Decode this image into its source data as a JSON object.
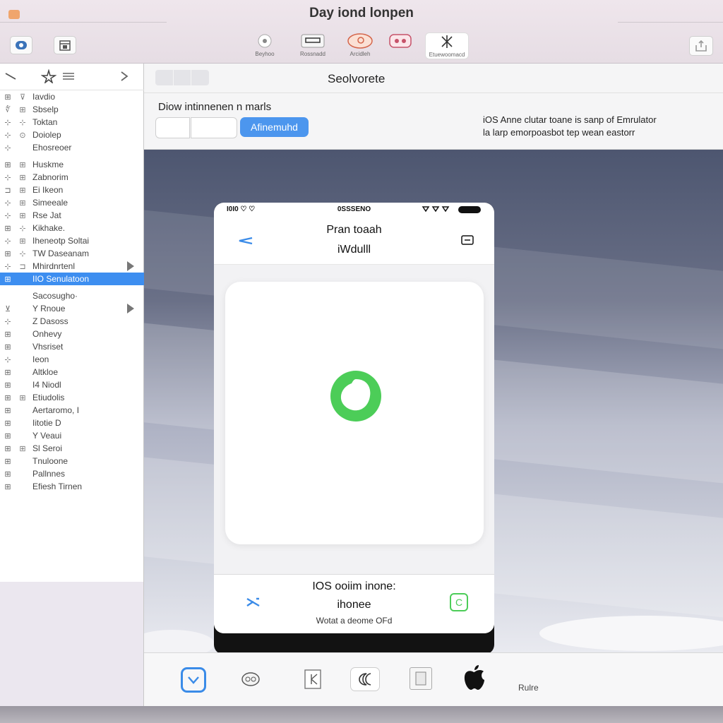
{
  "window": {
    "title": "Day iond lonpen"
  },
  "toolbar": {
    "tools": [
      {
        "label": "Beyhoo",
        "icon": "disc-icon"
      },
      {
        "label": "Rossnadd",
        "icon": "device-icon"
      },
      {
        "label": "Arcidleh",
        "icon": "cloud-icon"
      },
      {
        "label": "",
        "icon": "tag-icon"
      },
      {
        "label": "Etuewoomacd",
        "icon": "grid-icon"
      }
    ]
  },
  "sidebar": {
    "items": [
      {
        "label": "Iavdio",
        "icon1": "⊞",
        "icon2": "⊽"
      },
      {
        "label": "Sbselp",
        "icon1": "∜",
        "icon2": "⊞"
      },
      {
        "label": "Toktan",
        "icon1": "⊹",
        "icon2": "⊹"
      },
      {
        "label": "Doiolep",
        "icon1": "⊹",
        "icon2": "⊙"
      },
      {
        "label": "Ehosreoer",
        "icon1": "⊹",
        "icon2": ""
      },
      {
        "label": "Huskme",
        "icon1": "⊞",
        "icon2": "⊞"
      },
      {
        "label": "Zabnorim",
        "icon1": "⊹",
        "icon2": "⊞"
      },
      {
        "label": "Ei Ikeon",
        "icon1": "⊐",
        "icon2": "⊞"
      },
      {
        "label": "Simeeale",
        "icon1": "⊹",
        "icon2": "⊞"
      },
      {
        "label": "Rse Jat",
        "icon1": "⊹",
        "icon2": "⊞"
      },
      {
        "label": "Kikhake.",
        "icon1": "⊞",
        "icon2": "⊹"
      },
      {
        "label": "Iheneotp Soltai",
        "icon1": "⊹",
        "icon2": "⊞"
      },
      {
        "label": "TW Daseanam",
        "icon1": "⊞",
        "icon2": "⊹"
      },
      {
        "label": "Mhirdnrtenl",
        "icon1": "⊹",
        "icon2": "⊐",
        "arrow": true
      },
      {
        "label": "IIO Senulatoon",
        "icon1": "⊞",
        "icon2": "",
        "selected": true
      },
      {
        "label": "Sacosugho·",
        "icon1": "",
        "icon2": ""
      },
      {
        "label": "Y Rnoue",
        "icon1": "⊻",
        "icon2": "",
        "arrow": true
      },
      {
        "label": "Z Dasoss",
        "icon1": "⊹",
        "icon2": ""
      },
      {
        "label": "Onhevy",
        "icon1": "⊞",
        "icon2": ""
      },
      {
        "label": "Vhsriset",
        "icon1": "⊞",
        "icon2": ""
      },
      {
        "label": "Ieon",
        "icon1": "⊹",
        "icon2": ""
      },
      {
        "label": "Altkloe",
        "icon1": "⊞",
        "icon2": ""
      },
      {
        "label": "I4 Niodl",
        "icon1": "⊞",
        "icon2": ""
      },
      {
        "label": "Etiudolis",
        "icon1": "⊞",
        "icon2": "⊞"
      },
      {
        "label": "Aertaromo, I",
        "icon1": "⊞",
        "icon2": ""
      },
      {
        "label": "Iitotie D",
        "icon1": "⊞",
        "icon2": ""
      },
      {
        "label": "Y Veaui",
        "icon1": "⊞",
        "icon2": ""
      },
      {
        "label": "Sl Seroi",
        "icon1": "⊞",
        "icon2": "⊞"
      },
      {
        "label": "Tnuloone",
        "icon1": "⊞",
        "icon2": ""
      },
      {
        "label": "Pallnnes",
        "icon1": "⊞",
        "icon2": ""
      },
      {
        "label": "Efiesh Tirnen",
        "icon1": "⊞",
        "icon2": ""
      }
    ]
  },
  "main": {
    "header_title": "Seolvorete",
    "controls_label": "Diow intinnenen n marls",
    "primary_button": "Afinemuhd",
    "description_line1": "iOS Anne clutar toane is sanp of Emrulator",
    "description_line2": "la larp emorpoasbot tep wean eastorr"
  },
  "phone": {
    "status_left": "I0I0 ♡ ♡",
    "status_center": "0SSSENO",
    "title": "Pran toaah",
    "subtitle": "iWdulll",
    "bottom_title": "IOS ooiim inone:",
    "bottom_subtitle": "ihonee",
    "bottom_note": "Wotat a deome OFd",
    "accent_color": "#3a8be8",
    "green_color": "#4ccd58"
  },
  "dock": {
    "label": "Rulre"
  }
}
